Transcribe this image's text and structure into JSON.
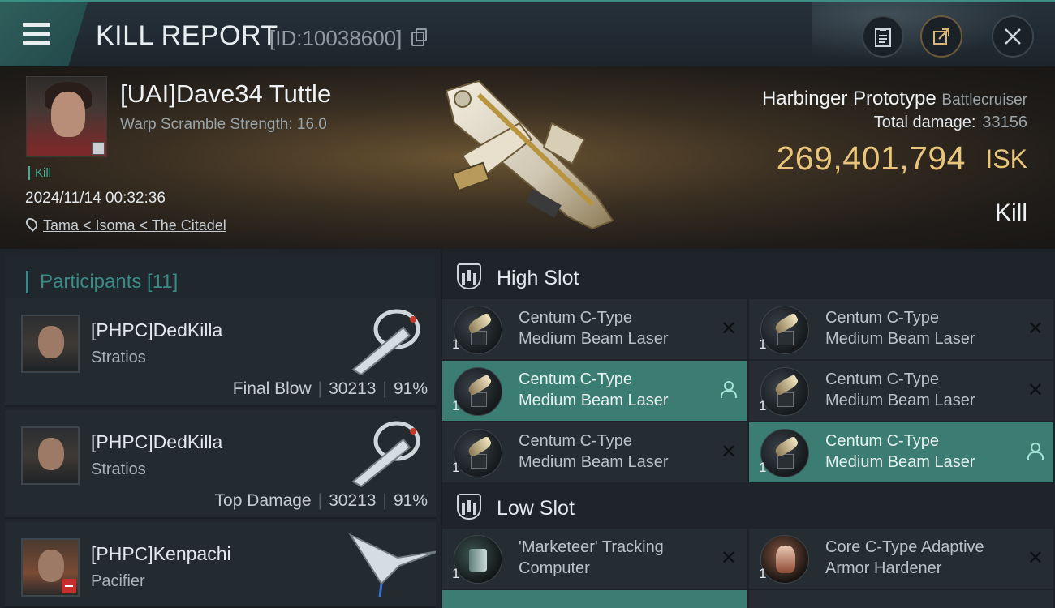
{
  "header": {
    "title": "KILL REPORT",
    "report_id": "[ID:10038600]",
    "icons": [
      "menu-icon",
      "copy-icon",
      "clipboard-icon",
      "share-icon",
      "close-icon"
    ]
  },
  "victim": {
    "name": "[UAI]Dave34 Tuttle",
    "warp_scramble": "Warp Scramble Strength: 16.0",
    "tag": "Kill",
    "datetime": "2024/11/14 00:32:36",
    "location": "Tama < Isoma < The Citadel",
    "ship_name": "Harbinger Prototype",
    "ship_class": "Battlecruiser",
    "total_damage_label": "Total damage:",
    "total_damage": "33156",
    "isk_value": "269,401,794",
    "isk_unit": "ISK",
    "result": "Kill"
  },
  "participants": {
    "title": "Participants [11]",
    "items": [
      {
        "name": "[PHPC]DedKilla",
        "ship": "Stratios",
        "role": "Final Blow",
        "damage": "30213",
        "percent": "91%"
      },
      {
        "name": "[PHPC]DedKilla",
        "ship": "Stratios",
        "role": "Top Damage",
        "damage": "30213",
        "percent": "91%"
      },
      {
        "name": "[PHPC]Kenpachi",
        "ship": "Pacifier"
      }
    ]
  },
  "slots": {
    "high": {
      "title": "High Slot",
      "modules": [
        {
          "line1": "Centum C-Type",
          "line2": "Medium Beam Laser",
          "qty": "1",
          "state": "destroyed"
        },
        {
          "line1": "Centum C-Type",
          "line2": "Medium Beam Laser",
          "qty": "1",
          "state": "destroyed"
        },
        {
          "line1": "Centum C-Type",
          "line2": "Medium Beam Laser",
          "qty": "1",
          "state": "dropped"
        },
        {
          "line1": "Centum C-Type",
          "line2": "Medium Beam Laser",
          "qty": "1",
          "state": "destroyed"
        },
        {
          "line1": "Centum C-Type",
          "line2": "Medium Beam Laser",
          "qty": "1",
          "state": "destroyed"
        },
        {
          "line1": "Centum C-Type",
          "line2": "Medium Beam Laser",
          "qty": "1",
          "state": "dropped"
        }
      ]
    },
    "low": {
      "title": "Low Slot",
      "modules": [
        {
          "line1": "'Marketeer' Tracking",
          "line2": "Computer",
          "qty": "1",
          "state": "destroyed"
        },
        {
          "line1": "Core C-Type Adaptive",
          "line2": "Armor Hardener",
          "qty": "1",
          "state": "destroyed"
        }
      ]
    }
  },
  "colors": {
    "accent": "#3b7d72",
    "isk": "#e8c57a",
    "participants_title": "#3a8a85"
  }
}
